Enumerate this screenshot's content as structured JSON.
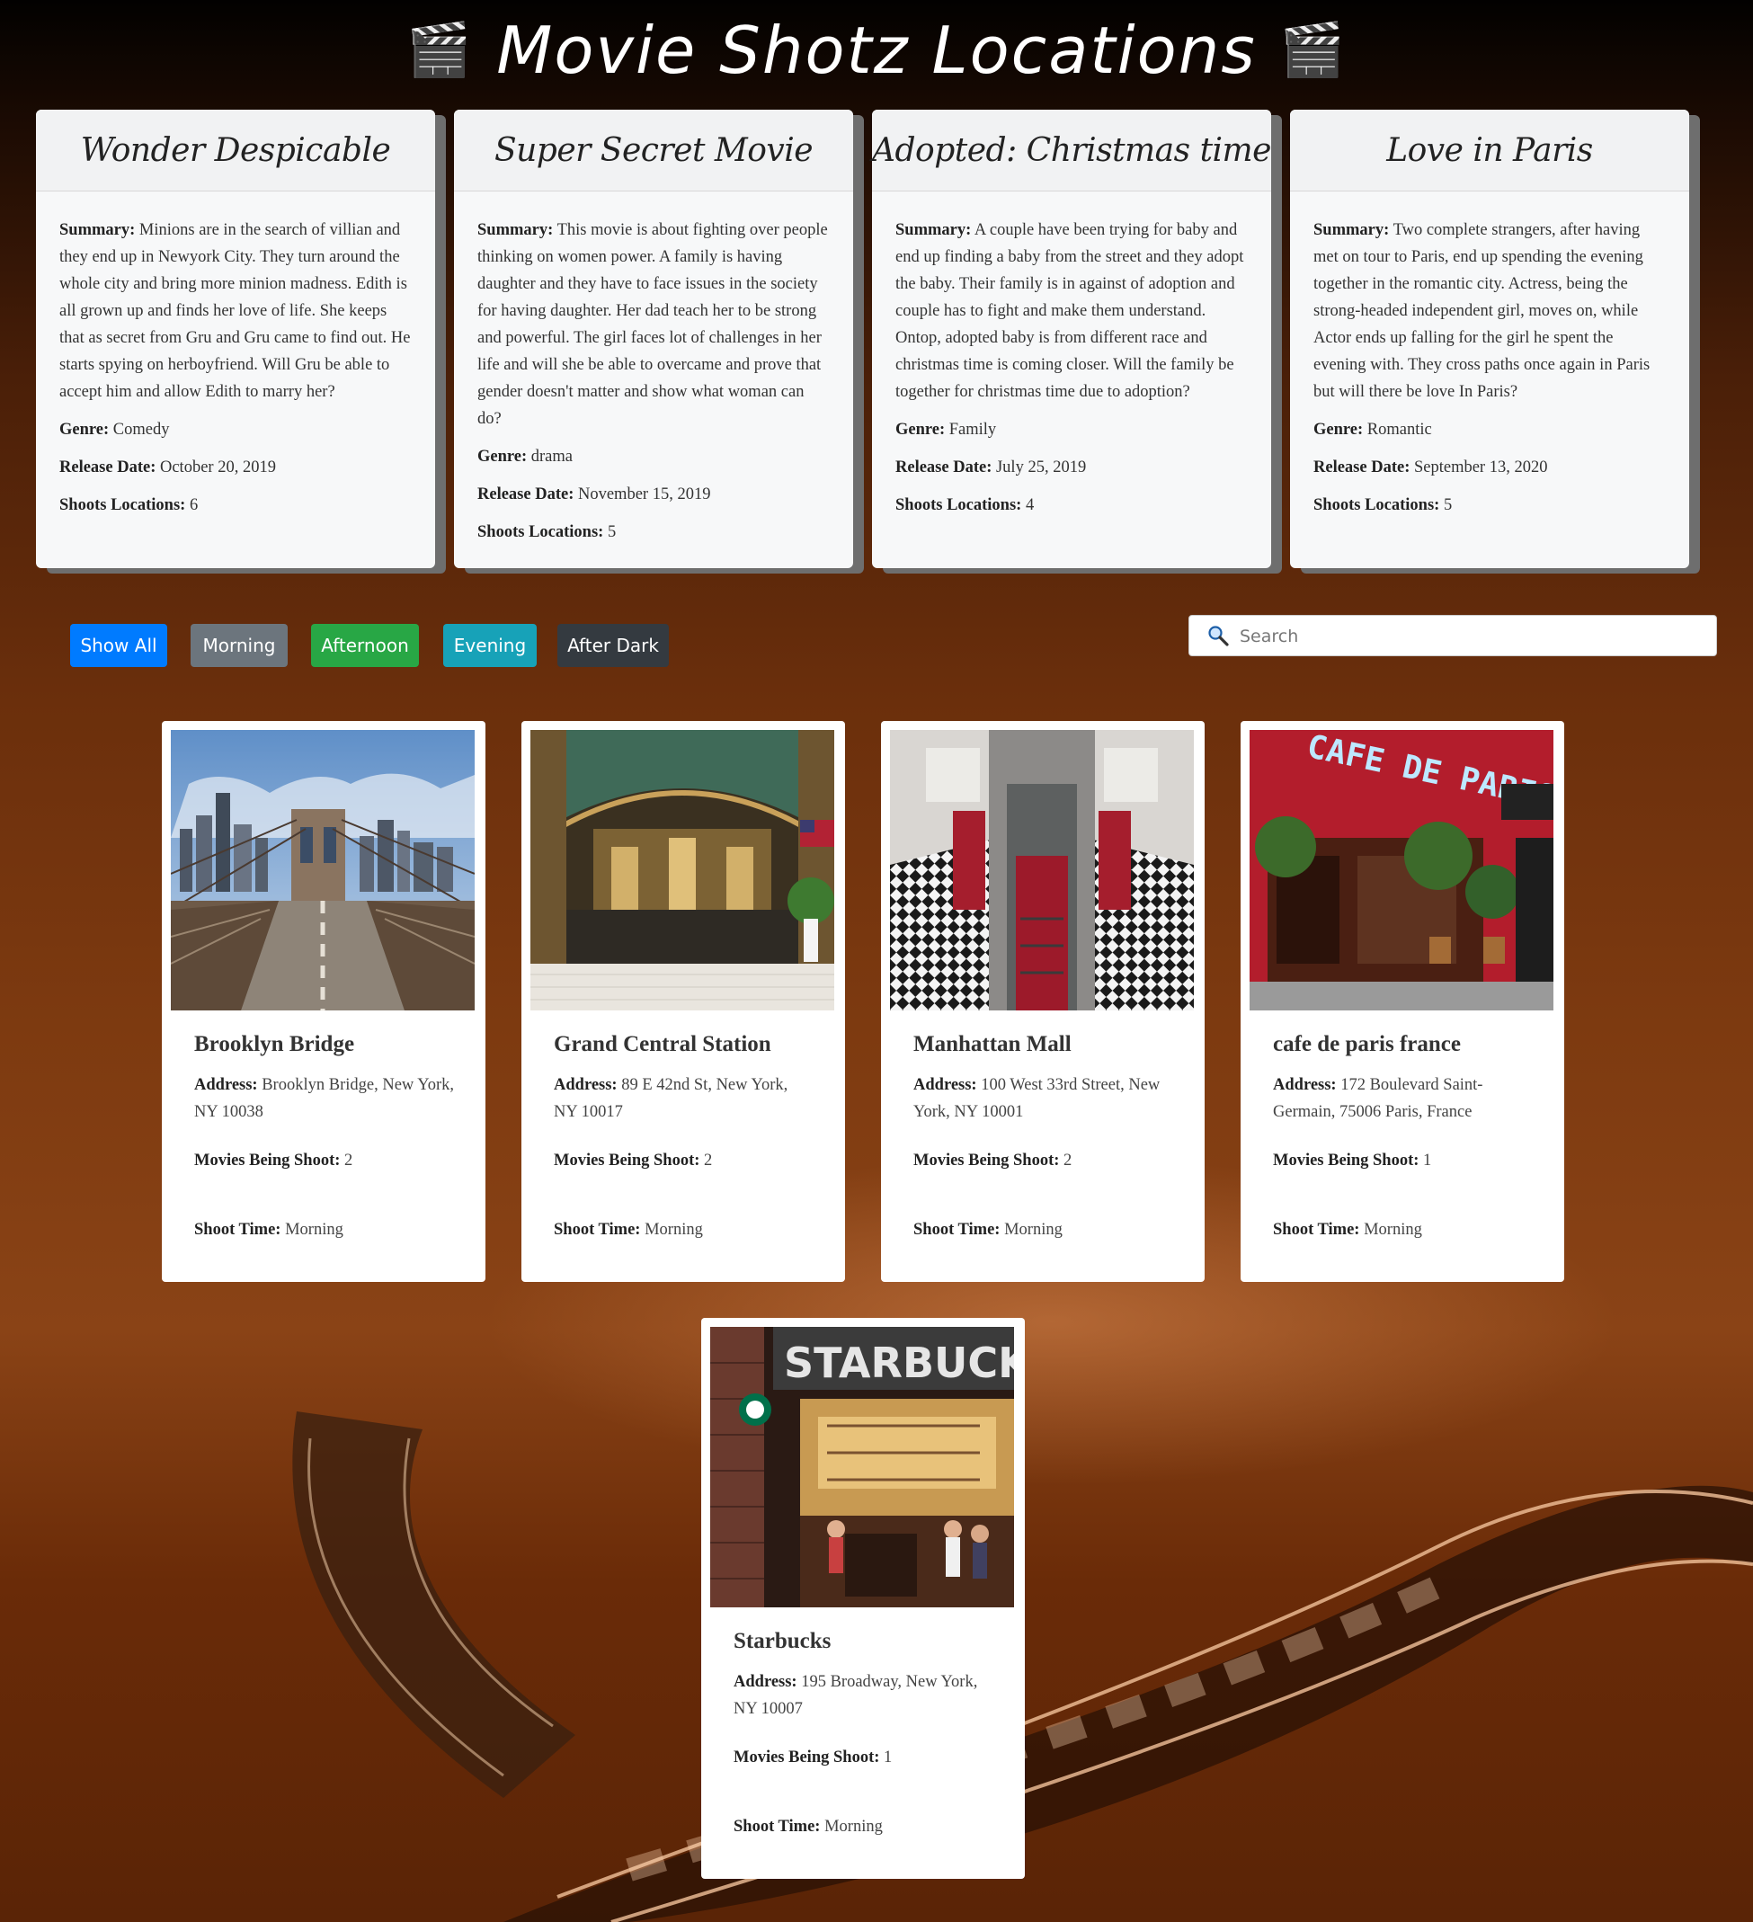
{
  "header": {
    "title": "Movie Shotz Locations",
    "clapper": "🎬"
  },
  "movies": [
    {
      "title": "Wonder Despicable",
      "summary_label": "Summary:",
      "summary": "Minions are in the search of villian and they end up in Newyork City. They turn around the whole city and bring more minion madness. Edith is all grown up and finds her love of life. She keeps that as secret from Gru and Gru came to find out. He starts spying on herboyfriend. Will Gru be able to accept him and allow Edith to marry her?",
      "genre_label": "Genre:",
      "genre": "Comedy",
      "release_label": "Release Date:",
      "release": "October 20, 2019",
      "shoots_label": "Shoots Locations:",
      "shoots": "6"
    },
    {
      "title": "Super Secret Movie",
      "summary_label": "Summary:",
      "summary": "This movie is about fighting over people thinking on women power. A family is having daughter and they have to face issues in the society for having daughter. Her dad teach her to be strong and powerful. The girl faces lot of challenges in her life and will she be able to overcame and prove that gender doesn't matter and show what woman can do?",
      "genre_label": "Genre:",
      "genre": "drama",
      "release_label": "Release Date:",
      "release": "November 15, 2019",
      "shoots_label": "Shoots Locations:",
      "shoots": "5"
    },
    {
      "title": "Adopted: Christmas time",
      "summary_label": "Summary:",
      "summary": "A couple have been trying for baby and end up finding a baby from the street and they adopt the baby. Their family is in against of adoption and couple has to fight and make them understand. Ontop, adopted baby is from different race and christmas time is coming closer. Will the family be together for christmas time due to adoption?",
      "genre_label": "Genre:",
      "genre": "Family",
      "release_label": "Release Date:",
      "release": "July 25, 2019",
      "shoots_label": "Shoots Locations:",
      "shoots": "4"
    },
    {
      "title": "Love in Paris",
      "summary_label": "Summary:",
      "summary": "Two complete strangers, after having met on tour to Paris, end up spending the evening together in the romantic city. Actress, being the strong-headed independent girl, moves on, while Actor ends up falling for the girl he spent the evening with. They cross paths once again in Paris but will there be love In Paris?",
      "genre_label": "Genre:",
      "genre": "Romantic",
      "release_label": "Release Date:",
      "release": "September 13, 2020",
      "shoots_label": "Shoots Locations:",
      "shoots": "5"
    }
  ],
  "filters": {
    "show_all": "Show All",
    "morning": "Morning",
    "afternoon": "Afternoon",
    "evening": "Evening",
    "after_dark": "After Dark",
    "colors": {
      "show_all": "#007bff",
      "morning": "#6c757d",
      "afternoon": "#28a745",
      "evening": "#17a2b8",
      "after_dark": "#343a40"
    }
  },
  "search": {
    "placeholder": "Search",
    "icon": "search-icon"
  },
  "locations": [
    {
      "name": "Brooklyn Bridge",
      "address_label": "Address:",
      "address": "Brooklyn Bridge, New York, NY 10038",
      "movies_label": "Movies Being Shoot:",
      "movies": "2",
      "time_label": "Shoot Time:",
      "time": "Morning"
    },
    {
      "name": "Grand Central Station",
      "address_label": "Address:",
      "address": "89 E 42nd St, New York, NY 10017",
      "movies_label": "Movies Being Shoot:",
      "movies": "2",
      "time_label": "Shoot Time:",
      "time": "Morning"
    },
    {
      "name": "Manhattan Mall",
      "address_label": "Address:",
      "address": "100 West 33rd Street, New York, NY 10001",
      "movies_label": "Movies Being Shoot:",
      "movies": "2",
      "time_label": "Shoot Time:",
      "time": "Morning"
    },
    {
      "name": "cafe de paris france",
      "address_label": "Address:",
      "address": "172 Boulevard Saint-Germain, 75006 Paris, France",
      "movies_label": "Movies Being Shoot:",
      "movies": "1",
      "time_label": "Shoot Time:",
      "time": "Morning"
    },
    {
      "name": "Starbucks",
      "address_label": "Address:",
      "address": "195 Broadway, New York, NY 10007",
      "movies_label": "Movies Being Shoot:",
      "movies": "1",
      "time_label": "Shoot Time:",
      "time": "Morning"
    }
  ],
  "photo_signs": {
    "cafe": "CAFE DE PARIS",
    "starbucks": "STARBUCKS"
  }
}
